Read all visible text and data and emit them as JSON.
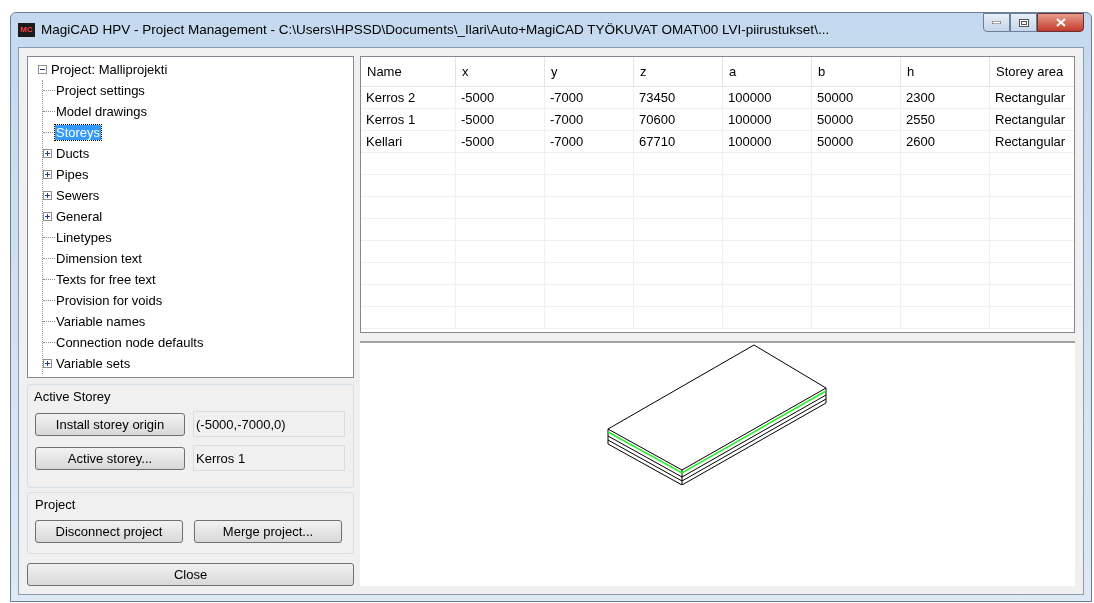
{
  "window": {
    "title": "MagiCAD HPV - Project Management - C:\\Users\\HPSSD\\Documents\\_Ilari\\Auto+MagiCAD TYÖKUVAT OMAT\\00 LVI-piirustukset\\...",
    "app_icon": "MC"
  },
  "tree": {
    "label": "Project: Malliprojekti",
    "expanded": true,
    "selected": false,
    "children": [
      {
        "label": "Project settings",
        "selected": false
      },
      {
        "label": "Model drawings",
        "selected": false
      },
      {
        "label": "Storeys",
        "selected": true
      },
      {
        "label": "Ducts",
        "selected": false,
        "expanded": false
      },
      {
        "label": "Pipes",
        "selected": false,
        "expanded": false
      },
      {
        "label": "Sewers",
        "selected": false,
        "expanded": false
      },
      {
        "label": "General",
        "selected": false,
        "expanded": false
      },
      {
        "label": "Linetypes",
        "selected": false
      },
      {
        "label": "Dimension text",
        "selected": false
      },
      {
        "label": "Texts for free text",
        "selected": false
      },
      {
        "label": "Provision for voids",
        "selected": false
      },
      {
        "label": "Variable names",
        "selected": false
      },
      {
        "label": "Connection node defaults",
        "selected": false
      },
      {
        "label": "Variable sets",
        "selected": false,
        "expanded": false
      }
    ]
  },
  "active_storey": {
    "title": "Active Storey",
    "rows": [
      {
        "button": "Install storey origin",
        "value": "(-5000,-7000,0)"
      },
      {
        "button": "Active storey...",
        "value": "Kerros 1"
      }
    ]
  },
  "project": {
    "title": "Project",
    "buttons": [
      "Disconnect project",
      "Merge project..."
    ]
  },
  "close_button": "Close",
  "table": {
    "columns": [
      "Name",
      "x",
      "y",
      "z",
      "a",
      "b",
      "h",
      "Storey area"
    ],
    "rows": [
      [
        "Kerros 2",
        "-5000",
        "-7000",
        "73450",
        "100000",
        "50000",
        "2300",
        "Rectangular"
      ],
      [
        "Kerros 1",
        "-5000",
        "-7000",
        "70600",
        "100000",
        "50000",
        "2550",
        "Rectangular"
      ],
      [
        "Kellari",
        "-5000",
        "-7000",
        "67710",
        "100000",
        "50000",
        "2600",
        "Rectangular"
      ]
    ]
  }
}
